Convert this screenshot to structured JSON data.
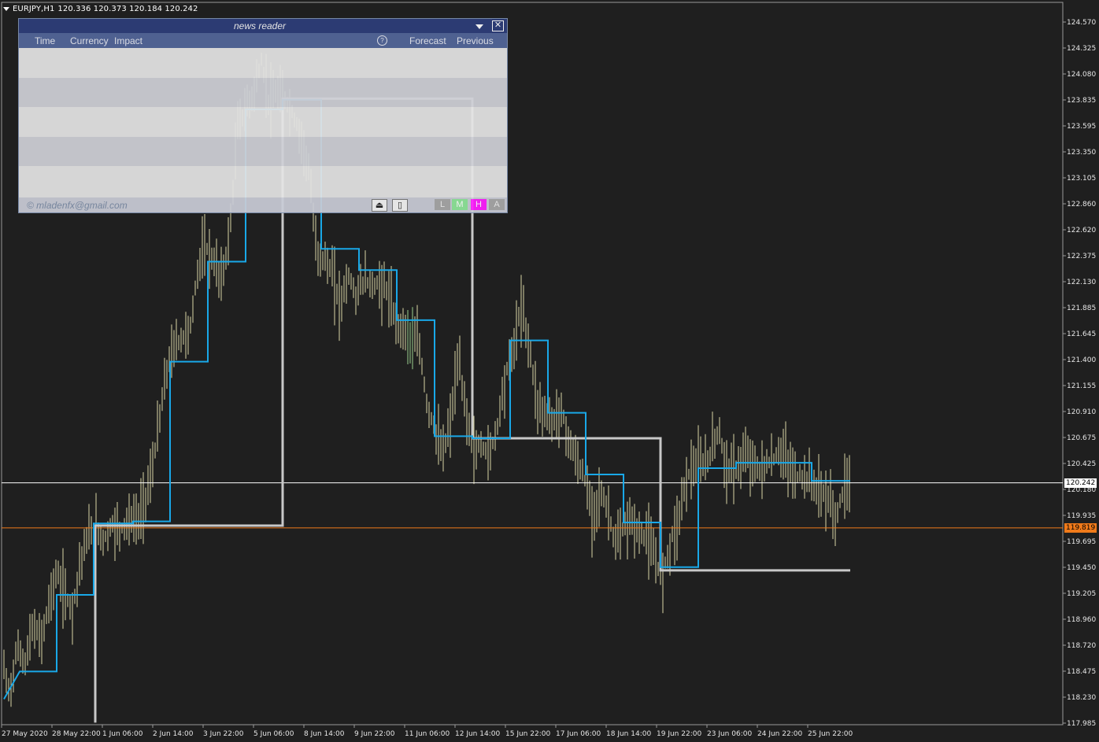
{
  "header": {
    "symbol": "EURJPY,H1",
    "ohlc": "120.336 120.373 120.184 120.242"
  },
  "colors": {
    "background": "#1f1f1f",
    "candles": "#d9d6a4",
    "blue_line": "#19a8e8",
    "gray_line": "#c8c8c8",
    "current_price_line": "#ffffff",
    "orange_line": "#f07a1a"
  },
  "price_tags": {
    "current": "120.242",
    "orange": "119.819"
  },
  "news_panel": {
    "title": "news reader",
    "close_glyph": "✕",
    "columns": {
      "time": "Time",
      "currency": "Currency",
      "impact": "Impact",
      "info": "?",
      "forecast": "Forecast",
      "previous": "Previous"
    },
    "email": "© mladenfx@gmail.com",
    "buttons": {
      "eject": "⏏",
      "frame": "▯",
      "low": "L",
      "medium": "M",
      "high": "H",
      "all": "A"
    }
  },
  "chart_data": {
    "type": "candlestick",
    "symbol": "EURJPY",
    "timeframe": "H1",
    "y_ticks": [
      "124.570",
      "124.325",
      "124.080",
      "123.835",
      "123.595",
      "123.350",
      "123.105",
      "122.860",
      "122.620",
      "122.375",
      "122.130",
      "121.885",
      "121.645",
      "121.400",
      "121.155",
      "120.910",
      "120.675",
      "120.425",
      "120.180",
      "119.935",
      "119.695",
      "119.450",
      "119.205",
      "118.960",
      "118.720",
      "118.475",
      "118.230",
      "117.985"
    ],
    "ylim": [
      117.985,
      124.57
    ],
    "x_ticks": [
      "27 May 2020",
      "28 May 22:00",
      "1 Jun 06:00",
      "2 Jun 14:00",
      "3 Jun 22:00",
      "5 Jun 06:00",
      "8 Jun 14:00",
      "9 Jun 22:00",
      "11 Jun 06:00",
      "12 Jun 14:00",
      "15 Jun 22:00",
      "17 Jun 06:00",
      "18 Jun 14:00",
      "19 Jun 22:00",
      "23 Jun 06:00",
      "24 Jun 22:00",
      "25 Jun 22:00"
    ],
    "current_price": 120.242,
    "orange_level": 119.819,
    "price_path": [
      [
        0,
        118.6
      ],
      [
        10,
        118.25
      ],
      [
        20,
        118.7
      ],
      [
        30,
        118.55
      ],
      [
        40,
        118.9
      ],
      [
        50,
        118.75
      ],
      [
        60,
        119.1
      ],
      [
        70,
        119.4
      ],
      [
        80,
        119.2
      ],
      [
        90,
        119.05
      ],
      [
        100,
        119.5
      ],
      [
        110,
        119.75
      ],
      [
        120,
        119.82
      ],
      [
        130,
        119.7
      ],
      [
        140,
        119.85
      ],
      [
        150,
        119.8
      ],
      [
        160,
        119.88
      ],
      [
        175,
        119.9
      ],
      [
        190,
        120.3
      ],
      [
        200,
        120.8
      ],
      [
        210,
        121.3
      ],
      [
        220,
        121.55
      ],
      [
        230,
        121.6
      ],
      [
        240,
        121.7
      ],
      [
        250,
        122.3
      ],
      [
        260,
        122.45
      ],
      [
        270,
        122.3
      ],
      [
        280,
        122.15
      ],
      [
        290,
        122.6
      ],
      [
        300,
        123.6
      ],
      [
        310,
        123.75
      ],
      [
        320,
        123.9
      ],
      [
        330,
        124.2
      ],
      [
        340,
        123.8
      ],
      [
        350,
        123.9
      ],
      [
        360,
        123.85
      ],
      [
        370,
        123.7
      ],
      [
        380,
        123.5
      ],
      [
        390,
        123.2
      ],
      [
        400,
        122.4
      ],
      [
        410,
        122.35
      ],
      [
        420,
        122.2
      ],
      [
        430,
        121.9
      ],
      [
        440,
        122.2
      ],
      [
        450,
        122.0
      ],
      [
        460,
        122.15
      ],
      [
        470,
        122.1
      ],
      [
        480,
        122.1
      ],
      [
        490,
        122.05
      ],
      [
        500,
        121.75
      ],
      [
        510,
        121.7
      ],
      [
        520,
        121.6
      ],
      [
        530,
        121.55
      ],
      [
        540,
        121.0
      ],
      [
        550,
        120.75
      ],
      [
        560,
        120.5
      ],
      [
        570,
        120.8
      ],
      [
        580,
        121.4
      ],
      [
        590,
        120.9
      ],
      [
        600,
        120.55
      ],
      [
        610,
        120.6
      ],
      [
        620,
        120.5
      ],
      [
        630,
        120.8
      ],
      [
        640,
        121.25
      ],
      [
        650,
        121.5
      ],
      [
        660,
        121.9
      ],
      [
        670,
        121.55
      ],
      [
        680,
        121.0
      ],
      [
        690,
        120.9
      ],
      [
        700,
        120.8
      ],
      [
        710,
        120.95
      ],
      [
        720,
        120.65
      ],
      [
        730,
        120.45
      ],
      [
        740,
        120.3
      ],
      [
        750,
        119.95
      ],
      [
        760,
        120.15
      ],
      [
        770,
        120.0
      ],
      [
        780,
        119.65
      ],
      [
        790,
        119.8
      ],
      [
        800,
        119.9
      ],
      [
        810,
        119.75
      ],
      [
        820,
        119.75
      ],
      [
        830,
        119.5
      ],
      [
        840,
        119.4
      ],
      [
        850,
        119.7
      ],
      [
        860,
        119.9
      ],
      [
        870,
        120.3
      ],
      [
        880,
        120.4
      ],
      [
        890,
        120.4
      ],
      [
        900,
        120.5
      ],
      [
        910,
        120.75
      ],
      [
        920,
        120.4
      ],
      [
        930,
        120.35
      ],
      [
        940,
        120.45
      ],
      [
        950,
        120.5
      ],
      [
        960,
        120.35
      ],
      [
        970,
        120.4
      ],
      [
        980,
        120.45
      ],
      [
        990,
        120.55
      ],
      [
        1000,
        120.4
      ],
      [
        1010,
        120.3
      ],
      [
        1020,
        120.3
      ],
      [
        1030,
        120.25
      ],
      [
        1040,
        120.15
      ],
      [
        1050,
        120.1
      ],
      [
        1060,
        119.9
      ],
      [
        1070,
        120.2
      ],
      [
        1078,
        120.24
      ]
    ],
    "blue_steps": [
      [
        3,
        118.21
      ],
      [
        23,
        118.47
      ],
      [
        70,
        118.47
      ],
      [
        70,
        119.19
      ],
      [
        117,
        119.19
      ],
      [
        117,
        119.86
      ],
      [
        167,
        119.86
      ],
      [
        167,
        119.88
      ],
      [
        214,
        119.88
      ],
      [
        214,
        121.38
      ],
      [
        262,
        121.38
      ],
      [
        262,
        122.32
      ],
      [
        310,
        122.32
      ],
      [
        310,
        123.75
      ],
      [
        357,
        123.75
      ],
      [
        357,
        123.84
      ],
      [
        406,
        123.84
      ],
      [
        406,
        122.44
      ],
      [
        454,
        122.44
      ],
      [
        454,
        122.24
      ],
      [
        502,
        122.24
      ],
      [
        502,
        121.77
      ],
      [
        550,
        121.77
      ],
      [
        550,
        120.68
      ],
      [
        598,
        120.68
      ],
      [
        598,
        120.66
      ],
      [
        646,
        120.66
      ],
      [
        646,
        121.58
      ],
      [
        694,
        121.58
      ],
      [
        694,
        120.9
      ],
      [
        742,
        120.9
      ],
      [
        742,
        120.32
      ],
      [
        790,
        120.32
      ],
      [
        790,
        119.87
      ],
      [
        837,
        119.87
      ],
      [
        837,
        119.45
      ],
      [
        885,
        119.45
      ],
      [
        885,
        120.38
      ],
      [
        933,
        120.38
      ],
      [
        933,
        120.43
      ],
      [
        981,
        120.43
      ],
      [
        981,
        120.43
      ],
      [
        1029,
        120.43
      ],
      [
        1029,
        120.26
      ],
      [
        1078,
        120.26
      ]
    ],
    "gray_steps": [
      [
        119,
        117.99
      ],
      [
        119,
        119.84
      ],
      [
        357,
        119.84
      ],
      [
        357,
        123.85
      ],
      [
        598,
        123.85
      ],
      [
        598,
        120.66
      ],
      [
        837,
        120.66
      ],
      [
        837,
        119.42
      ],
      [
        1078,
        119.42
      ]
    ]
  }
}
